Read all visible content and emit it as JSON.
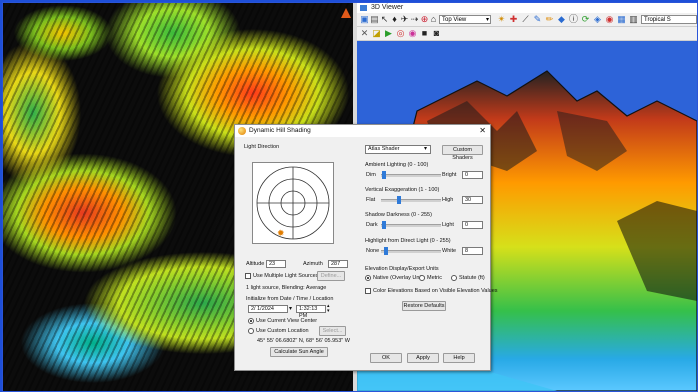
{
  "viewer": {
    "title": "3D Viewer",
    "view_select": "Top View",
    "sky_select": "Tropical S"
  },
  "dialog": {
    "title": "Dynamic Hill Shading",
    "close_glyph": "✕",
    "light_direction_label": "Light Direction",
    "altitude_label": "Altitude",
    "altitude_value": "23",
    "azimuth_label": "Azimuth",
    "azimuth_value": "287",
    "multiple_lights_label": "Use Multiple Light Sources",
    "define_button": "Define...",
    "blend_text": "1 light source, Blending: Average",
    "init_label": "Initialize from Date / Time / Location",
    "date_value": "2/ 1/2024",
    "time_value": "1:32:13 PM",
    "use_view_center": "Use Current View Center",
    "use_custom_location": "Use Custom Location",
    "select_button": "Select...",
    "coords": "45° 55' 06.6802\" N, 68° 56' 05.953\" W",
    "calc_button": "Calculate Sun Angle",
    "shader_select": "Atlas Shader",
    "custom_shaders_button": "Custom Shaders",
    "ambient_label": "Ambient Lighting (0 - 100)",
    "dim_label": "Dim",
    "bright_label": "Bright",
    "ambient_value": "0",
    "ambient_level": 0.02,
    "vert_exag_label": "Vertical Exaggeration (1 - 100)",
    "flat_label": "Flat",
    "high_label": "High",
    "vert_exag_value": "30",
    "vert_exag_level": 0.29,
    "shadow_label": "Shadow Darkness (0 - 255)",
    "dark_label": "Dark",
    "light_label": "Light",
    "shadow_value": "0",
    "shadow_level": 0.02,
    "highlight_label": "Highlight from Direct Light (0 - 255)",
    "none_label": "None",
    "white_label": "White",
    "highlight_value": "8",
    "highlight_level": 0.05,
    "units_label": "Elevation Display/Export Units",
    "unit_native": "Native (Overlay Units",
    "unit_metric": "Metric",
    "unit_statute": "Statute (ft)",
    "color_elev_label": "Color Elevations Based on Visible Elevation Values",
    "restore_button": "Restore Defaults",
    "ok_button": "OK",
    "apply_button": "Apply",
    "help_button": "Help"
  }
}
